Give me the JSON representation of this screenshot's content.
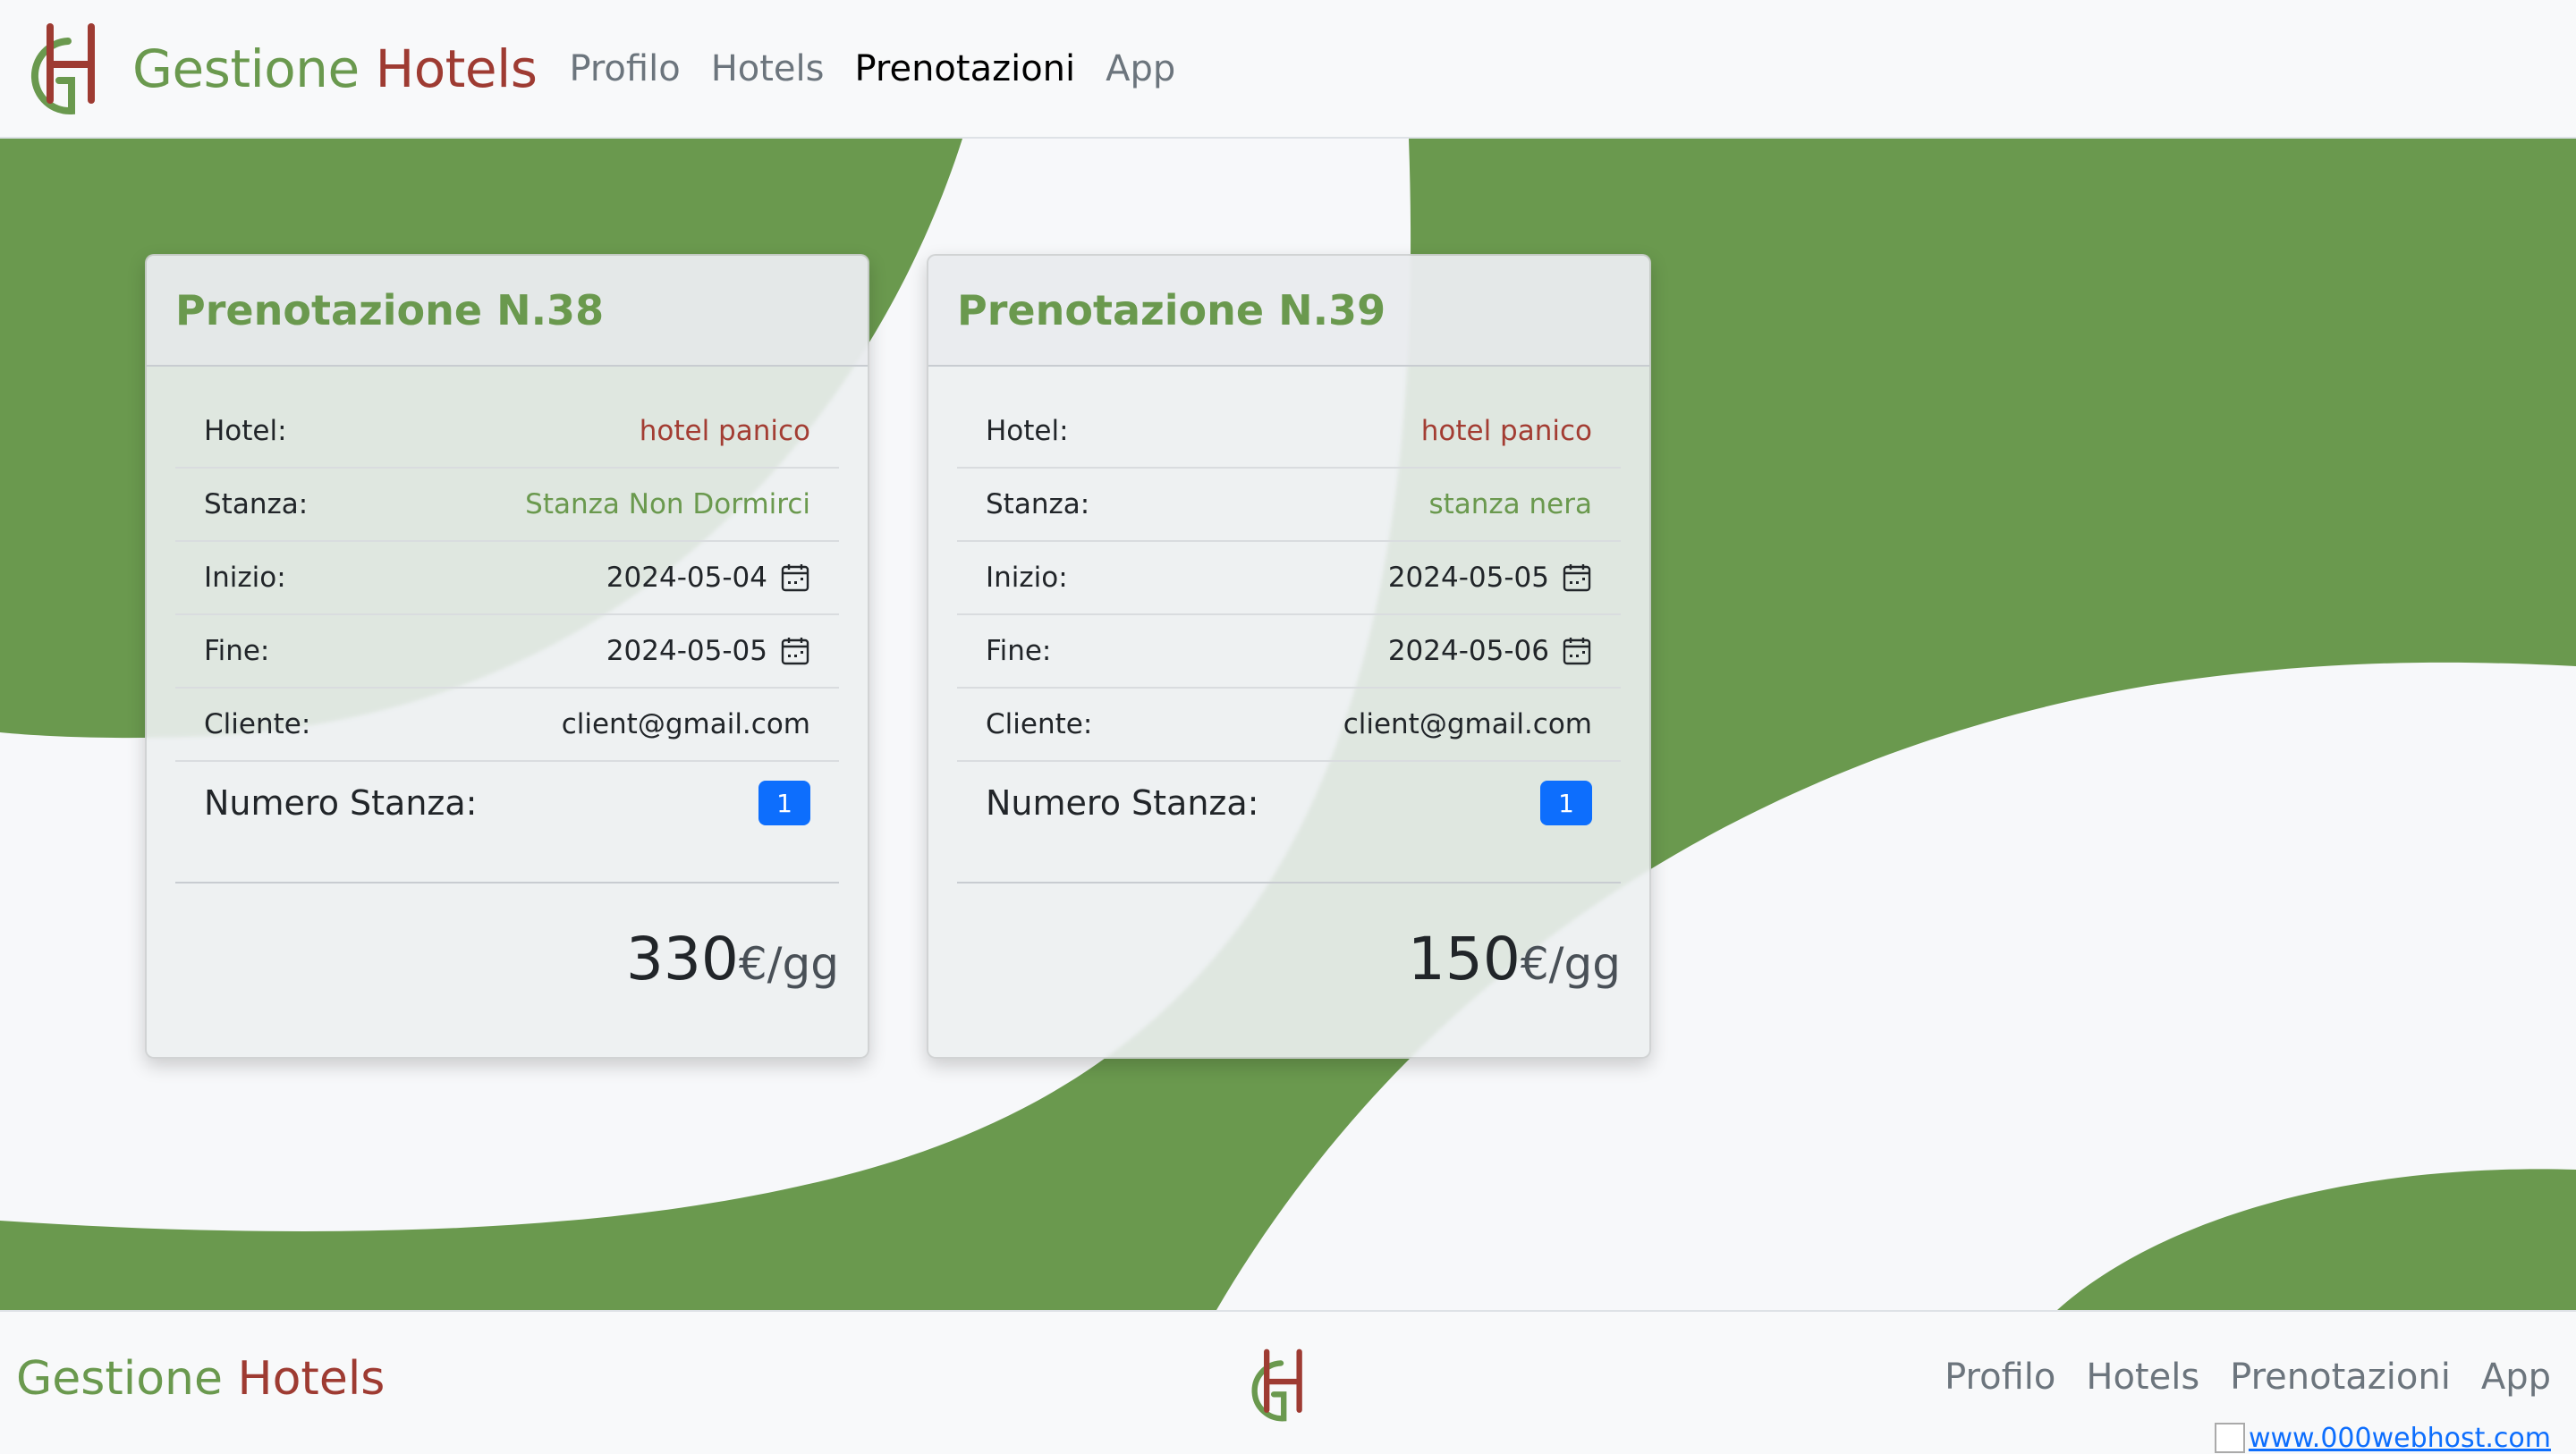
{
  "brand": {
    "part1": "Gestione",
    "part2": "Hotels"
  },
  "nav": {
    "items": [
      "Profilo",
      "Hotels",
      "Prenotazioni",
      "App"
    ],
    "active": "Prenotazioni"
  },
  "colors": {
    "green": "#6a994e",
    "red": "#9e3b32",
    "badge": "#0d6efd"
  },
  "cards": [
    {
      "title": "Prenotazione N.38",
      "hotel_label": "Hotel:",
      "hotel": "hotel panico",
      "stanza_label": "Stanza:",
      "stanza": "Stanza Non Dormirci",
      "inizio_label": "Inizio:",
      "inizio": "2024-05-04",
      "fine_label": "Fine:",
      "fine": "2024-05-05",
      "cliente_label": "Cliente:",
      "cliente": "client@gmail.com",
      "numero_label": "Numero Stanza:",
      "numero": "1",
      "price": "330",
      "unit": "€/gg"
    },
    {
      "title": "Prenotazione N.39",
      "hotel_label": "Hotel:",
      "hotel": "hotel panico",
      "stanza_label": "Stanza:",
      "stanza": "stanza nera",
      "inizio_label": "Inizio:",
      "inizio": "2024-05-05",
      "fine_label": "Fine:",
      "fine": "2024-05-06",
      "cliente_label": "Cliente:",
      "cliente": "client@gmail.com",
      "numero_label": "Numero Stanza:",
      "numero": "1",
      "price": "150",
      "unit": "€/gg"
    }
  ],
  "footer": {
    "brand_part1": "Gestione",
    "brand_part2": "Hotels",
    "nav": [
      "Profilo",
      "Hotels",
      "Prenotazioni",
      "App"
    ],
    "host_link": "www.000webhost.com"
  },
  "icons": {
    "calendar": "calendar-icon",
    "logo": "gh-logo-icon"
  }
}
